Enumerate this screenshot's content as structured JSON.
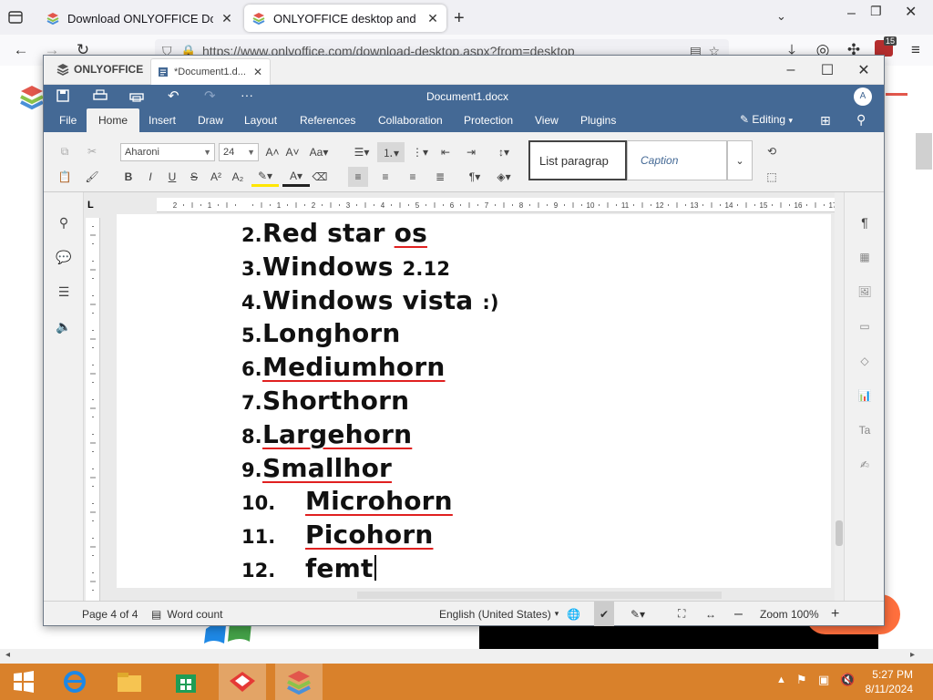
{
  "browser": {
    "tabs": [
      {
        "title": "Download ONLYOFFICE Docs |",
        "active": false
      },
      {
        "title": "ONLYOFFICE desktop and mob",
        "active": true
      }
    ],
    "url": "https://www.onlyoffice.com/download-desktop.aspx?from=desktop",
    "extension_badge": "15"
  },
  "app": {
    "brand": "ONLYOFFICE",
    "doc_tab": "*Document1.d...",
    "title": "Document1.docx",
    "avatar": "A",
    "menus": [
      "File",
      "Home",
      "Insert",
      "Draw",
      "Layout",
      "References",
      "Collaboration",
      "Protection",
      "View",
      "Plugins"
    ],
    "active_menu": "Home",
    "editing": "Editing",
    "font": "Aharoni",
    "size": "24",
    "style1": "List paragrap",
    "style2": "Caption"
  },
  "document": {
    "lines": [
      {
        "num": "2.",
        "parts": [
          {
            "t": "Red star "
          },
          {
            "t": "os",
            "sp": true
          }
        ]
      },
      {
        "num": "3.",
        "parts": [
          {
            "t": "Windows "
          },
          {
            "t": "2.12",
            "small": true
          }
        ]
      },
      {
        "num": "4.",
        "parts": [
          {
            "t": "Windows vista "
          },
          {
            "t": ":)",
            "small": true
          }
        ]
      },
      {
        "num": "5.",
        "parts": [
          {
            "t": "Longhorn"
          }
        ]
      },
      {
        "num": "6.",
        "parts": [
          {
            "t": "Mediumhorn",
            "sp": true
          }
        ]
      },
      {
        "num": "7.",
        "parts": [
          {
            "t": "Shorthorn"
          }
        ]
      },
      {
        "num": "8.",
        "parts": [
          {
            "t": "Largehorn",
            "sp": true
          }
        ]
      },
      {
        "num": "9.",
        "parts": [
          {
            "t": "Smallhor",
            "sp": true
          }
        ]
      },
      {
        "num": "10.",
        "parts": [
          {
            "t": "Microhorn",
            "sp": true
          }
        ]
      },
      {
        "num": "11.",
        "parts": [
          {
            "t": "Picohorn",
            "sp": true
          }
        ]
      },
      {
        "num": "12.",
        "parts": [
          {
            "t": "femt"
          }
        ]
      }
    ]
  },
  "status": {
    "page": "Page 4 of 4",
    "wordcount": "Word count",
    "language": "English (United States)",
    "zoom": "Zoom 100%"
  },
  "taskbar": {
    "time": "5:27 PM",
    "date": "8/11/2024"
  },
  "colors": {
    "header": "#446995",
    "taskbar": "#d9812b"
  }
}
